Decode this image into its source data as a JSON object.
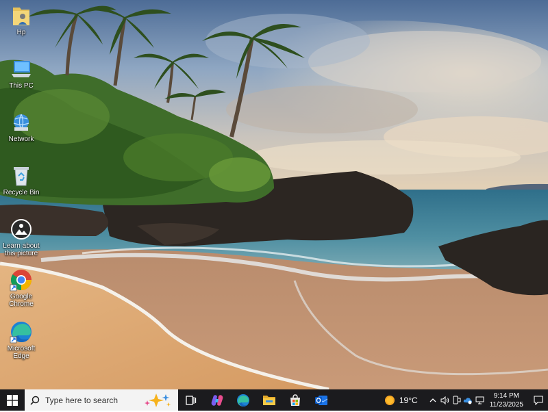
{
  "desktop": {
    "icons": [
      {
        "label": "Hp",
        "icon": "user-folder-icon"
      },
      {
        "label": "This PC",
        "icon": "computer-icon"
      },
      {
        "label": "Network",
        "icon": "network-icon"
      },
      {
        "label": "Recycle Bin",
        "icon": "recycle-bin-icon"
      },
      {
        "label": "Learn about this picture",
        "icon": "learn-picture-icon"
      },
      {
        "label": "Google Chrome",
        "icon": "chrome-icon"
      },
      {
        "label": "Microsoft Edge",
        "icon": "edge-icon"
      }
    ]
  },
  "taskbar": {
    "search_placeholder": "Type here to search",
    "apps": [
      "task-view-icon",
      "copilot-icon",
      "edge-icon",
      "file-explorer-icon",
      "microsoft-store-icon",
      "outlook-icon"
    ],
    "weather": {
      "temp": "19°C",
      "icon": "sun-icon"
    },
    "clock": {
      "time": "9:14 PM",
      "date": "11/23/2025"
    }
  },
  "colors": {
    "taskbar_bg": "#1b1b1e",
    "search_bg": "#f3f3f3"
  }
}
